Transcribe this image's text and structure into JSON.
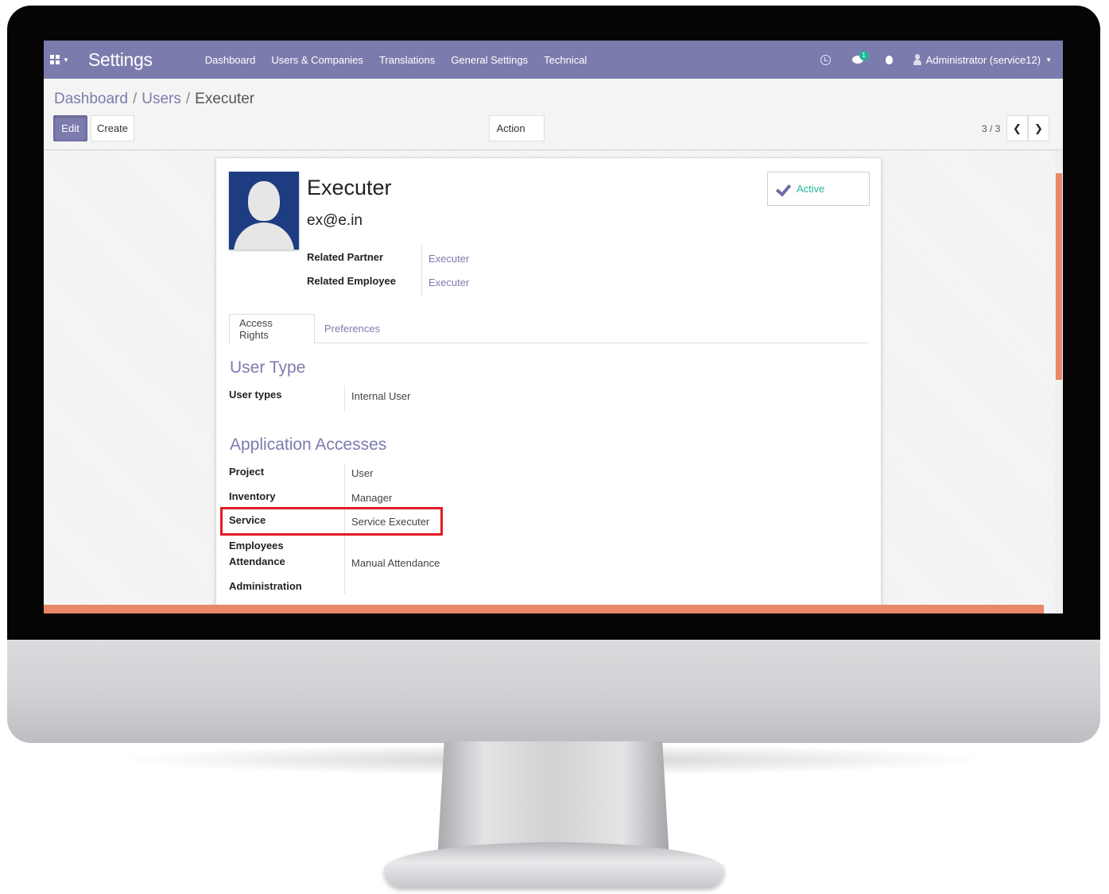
{
  "navbar": {
    "app_title": "Settings",
    "menu": [
      "Dashboard",
      "Users & Companies",
      "Translations",
      "General Settings",
      "Technical"
    ],
    "chat_badge": "1",
    "user": "Administrator (service12)"
  },
  "breadcrumb": {
    "items": [
      "Dashboard",
      "Users"
    ],
    "current": "Executer",
    "separator": "/"
  },
  "buttons": {
    "edit": "Edit",
    "create": "Create",
    "action": "Action"
  },
  "pager": {
    "value": "3 / 3"
  },
  "record": {
    "name": "Executer",
    "login": "ex@e.in",
    "related_partner_label": "Related Partner",
    "related_partner": "Executer",
    "related_employee_label": "Related Employee",
    "related_employee": "Executer",
    "active_label": "Active"
  },
  "tabs": [
    "Access Rights",
    "Preferences"
  ],
  "user_type": {
    "title": "User Type",
    "label": "User types",
    "value": "Internal User"
  },
  "app_access": {
    "title": "Application Accesses",
    "rows": [
      {
        "label": "Project",
        "value": "User"
      },
      {
        "label": "Inventory",
        "value": "Manager"
      },
      {
        "label": "Service",
        "value": "Service Executer"
      },
      {
        "label": "Employees",
        "value": ""
      },
      {
        "label": "Attendance",
        "value": "Manual Attendance"
      },
      {
        "label": "Administration",
        "value": ""
      }
    ]
  },
  "colors": {
    "brand": "#7c7bad",
    "accent_orange": "#e9876a",
    "active_green": "#21b799",
    "highlight_red": "#e21b24"
  },
  "icons": [
    "apps-grid-icon",
    "clock-icon",
    "chat-icon",
    "bug-icon",
    "user-icon",
    "check-icon",
    "chevron-left-icon",
    "chevron-right-icon",
    "caret-down-icon"
  ]
}
